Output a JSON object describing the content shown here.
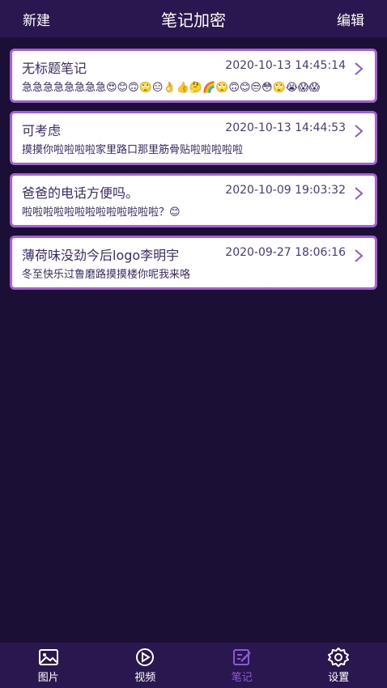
{
  "header": {
    "new_label": "新建",
    "title": "笔记加密",
    "edit_label": "编辑"
  },
  "notes": [
    {
      "title": "无标题笔记",
      "time": "2020-10-13 14:45:14",
      "content": "急急急急急急急急😍😊🙃🙄😑👌👍🤔🌈🙄🙃😊😒😳🙄😭😱😱"
    },
    {
      "title": "可考虑",
      "time": "2020-10-13 14:44:53",
      "content": "摸摸你啦啦啦啦家里路口那里筋骨贴啦啦啦啦啦"
    },
    {
      "title": "爸爸的电话方便吗。",
      "time": "2020-10-09 19:03:32",
      "content": "啦啦啦啦啦啦啦啦啦啦啦啦啦？😊"
    },
    {
      "title": "薄荷味没劲今后logo李明宇",
      "time": "2020-09-27 18:06:16",
      "content": "冬至快乐过鲁磨路摸摸楼你呢我来咯"
    }
  ],
  "tabs": [
    {
      "label": "图片",
      "icon": "image-icon"
    },
    {
      "label": "视频",
      "icon": "video-play-icon"
    },
    {
      "label": "笔记",
      "icon": "note-edit-icon"
    },
    {
      "label": "设置",
      "icon": "gear-icon"
    }
  ],
  "colors": {
    "background": "#1c0f35",
    "bar": "#2a1750",
    "card_border": "#a560d8",
    "accent": "#8a5ad6"
  }
}
